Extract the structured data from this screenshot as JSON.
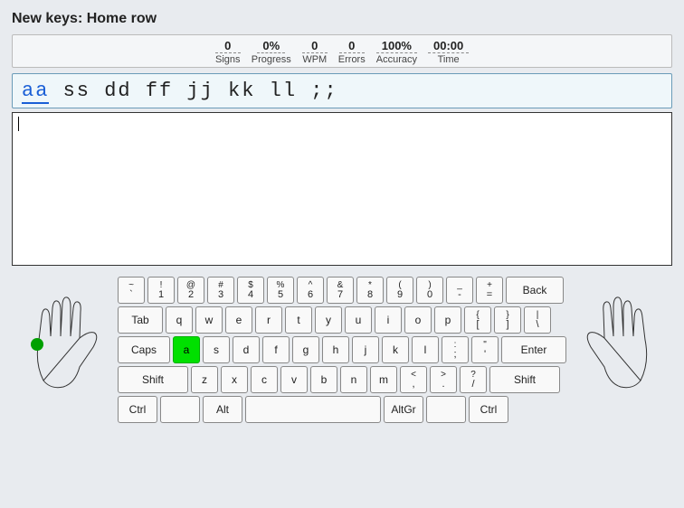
{
  "title": "New keys: Home row",
  "stats": {
    "signs": {
      "value": "0",
      "label": "Signs"
    },
    "progress": {
      "value": "0%",
      "label": "Progress"
    },
    "wpm": {
      "value": "0",
      "label": "WPM"
    },
    "errors": {
      "value": "0",
      "label": "Errors"
    },
    "accuracy": {
      "value": "100%",
      "label": "Accuracy"
    },
    "time": {
      "value": "00:00",
      "label": "Time"
    }
  },
  "target": {
    "highlight": "aa",
    "rest": " ss dd ff jj kk ll ;;"
  },
  "keyboard": {
    "row1": [
      {
        "top": "~",
        "bot": "`"
      },
      {
        "top": "!",
        "bot": "1"
      },
      {
        "top": "@",
        "bot": "2"
      },
      {
        "top": "#",
        "bot": "3"
      },
      {
        "top": "$",
        "bot": "4"
      },
      {
        "top": "%",
        "bot": "5"
      },
      {
        "top": "^",
        "bot": "6"
      },
      {
        "top": "&",
        "bot": "7"
      },
      {
        "top": "*",
        "bot": "8"
      },
      {
        "top": "(",
        "bot": "9"
      },
      {
        "top": ")",
        "bot": "0"
      },
      {
        "top": "_",
        "bot": "-"
      },
      {
        "top": "+",
        "bot": "="
      }
    ],
    "back": "Back",
    "tab": "Tab",
    "row2": [
      "q",
      "w",
      "e",
      "r",
      "t",
      "y",
      "u",
      "i",
      "o",
      "p"
    ],
    "row2b": [
      {
        "top": "{",
        "bot": "["
      },
      {
        "top": "}",
        "bot": "]"
      },
      {
        "top": "|",
        "bot": "\\"
      }
    ],
    "caps": "Caps",
    "row3": [
      "a",
      "s",
      "d",
      "f",
      "g",
      "h",
      "j",
      "k",
      "l"
    ],
    "row3b": [
      {
        "top": ":",
        "bot": ";"
      },
      {
        "top": "\"",
        "bot": "'"
      }
    ],
    "enter": "Enter",
    "shiftL": "Shift",
    "row4": [
      "z",
      "x",
      "c",
      "v",
      "b",
      "n",
      "m"
    ],
    "row4b": [
      {
        "top": "<",
        "bot": ","
      },
      {
        "top": ">",
        "bot": "."
      },
      {
        "top": "?",
        "bot": "/"
      }
    ],
    "shiftR": "Shift",
    "ctrlL": "Ctrl",
    "alt": "Alt",
    "altgr": "AltGr",
    "ctrlR": "Ctrl",
    "highlighted_key": "a"
  }
}
